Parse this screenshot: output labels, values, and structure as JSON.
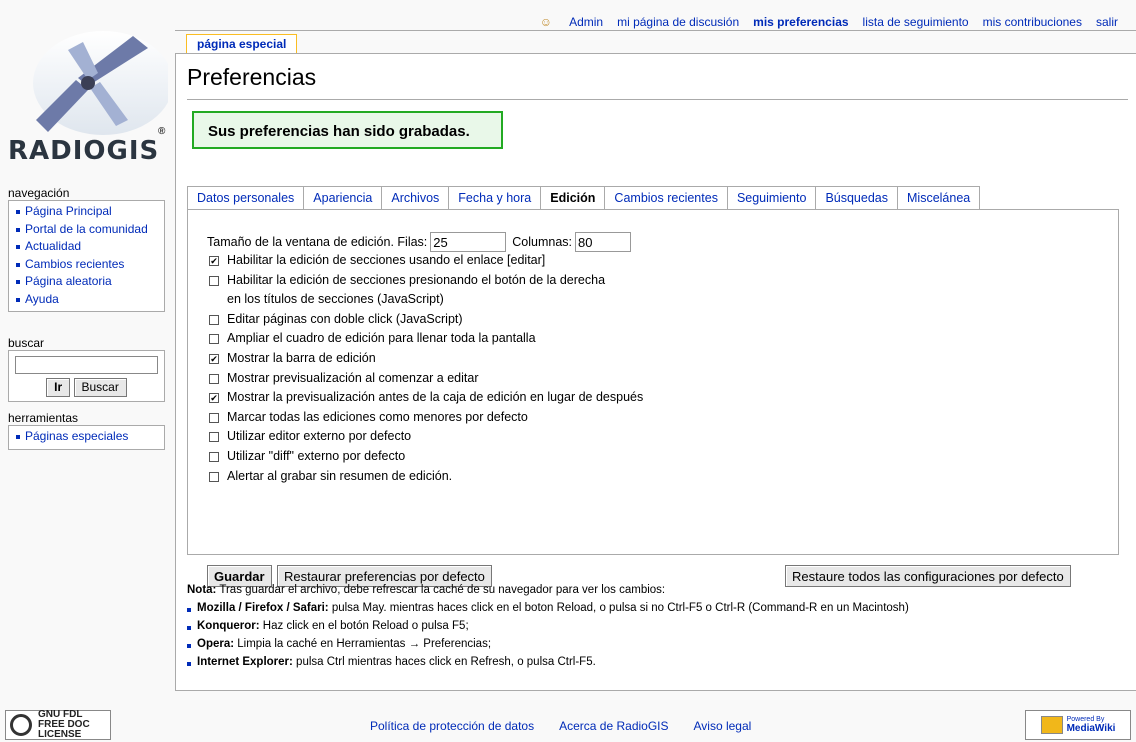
{
  "personal": {
    "items": [
      {
        "label": "Admin",
        "active": false
      },
      {
        "label": "mi página de discusión",
        "active": false
      },
      {
        "label": "mis preferencias",
        "active": true
      },
      {
        "label": "lista de seguimiento",
        "active": false
      },
      {
        "label": "mis contribuciones",
        "active": false
      },
      {
        "label": "salir",
        "active": false
      }
    ]
  },
  "logo": {
    "text": "RADIOGIS",
    "mark": "®"
  },
  "special_tab": "página especial",
  "page_title": "Preferencias",
  "success_message": "Sus preferencias han sido grabadas.",
  "tabs": [
    {
      "label": "Datos personales",
      "selected": false
    },
    {
      "label": "Apariencia",
      "selected": false
    },
    {
      "label": "Archivos",
      "selected": false
    },
    {
      "label": "Fecha y hora",
      "selected": false
    },
    {
      "label": "Edición",
      "selected": true
    },
    {
      "label": "Cambios recientes",
      "selected": false
    },
    {
      "label": "Seguimiento",
      "selected": false
    },
    {
      "label": "Búsquedas",
      "selected": false
    },
    {
      "label": "Miscelánea",
      "selected": false
    }
  ],
  "editbox": {
    "label": "Tamaño de la ventana de edición. Filas:",
    "rows": "25",
    "cols_label": "Columnas:",
    "cols": "80"
  },
  "options": [
    {
      "label": "Habilitar la edición de secciones usando el enlace [editar]",
      "checked": true
    },
    {
      "label": "Habilitar la edición de secciones presionando el botón de la derecha",
      "checked": false
    },
    {
      "label": "en los títulos de secciones (JavaScript)",
      "continuation": true
    },
    {
      "label": "Editar páginas con doble click (JavaScript)",
      "checked": false
    },
    {
      "label": "Ampliar el cuadro de edición para llenar toda la pantalla",
      "checked": false
    },
    {
      "label": "Mostrar la barra de edición",
      "checked": true
    },
    {
      "label": "Mostrar previsualización al comenzar a editar",
      "checked": false
    },
    {
      "label": "Mostrar la previsualización antes de la caja de edición en lugar de después",
      "checked": true
    },
    {
      "label": "Marcar todas las ediciones como menores por defecto",
      "checked": false
    },
    {
      "label": "Utilizar editor externo por defecto",
      "checked": false
    },
    {
      "label": "Utilizar \"diff\" externo por defecto",
      "checked": false
    },
    {
      "label": "Alertar al grabar sin resumen de edición.",
      "checked": false
    }
  ],
  "buttons": {
    "save": "Guardar",
    "restore": "Restaurar preferencias por defecto",
    "restore_all": "Restaure todos las configuraciones por defecto"
  },
  "note": {
    "intro_bold": "Nota:",
    "intro": " Tras guardar el archivo, debe refrescar la caché de su navegador para ver los cambios:",
    "items": [
      {
        "bold": "Mozilla / Firefox / Safari:",
        "text": " pulsa May. mientras haces click en el boton Reload, o pulsa si no Ctrl-F5 o Ctrl-R (Command-R en un Macintosh)"
      },
      {
        "bold": "Konqueror:",
        "text": " Haz click en el botón Reload o pulsa F5;"
      },
      {
        "bold": "Opera:",
        "text": " Limpia la caché en Herramientas → Preferencias;"
      },
      {
        "bold": "Internet Explorer:",
        "text": " pulsa Ctrl mientras haces click en Refresh, o pulsa Ctrl-F5."
      }
    ]
  },
  "sidebar": {
    "nav_title": "navegación",
    "nav_items": [
      "Página Principal",
      "Portal de la comunidad",
      "Actualidad",
      "Cambios recientes",
      "Página aleatoria",
      "Ayuda"
    ],
    "search_title": "buscar",
    "search_value": "",
    "go_label": "Ir",
    "search_label": "Buscar",
    "tools_title": "herramientas",
    "tools_items": [
      "Páginas especiales"
    ]
  },
  "footer": {
    "links": [
      "Política de protección de datos",
      "Acerca de RadioGIS",
      "Aviso legal"
    ],
    "gnu_badge": [
      "GNU FDL",
      "FREE DOC",
      "LICENSE"
    ],
    "mw_badge": [
      "Powered By",
      "MediaWiki"
    ]
  },
  "colors": {
    "link": "#002bb8",
    "success_border": "#22aa22",
    "tab_accent": "#fabd23"
  }
}
